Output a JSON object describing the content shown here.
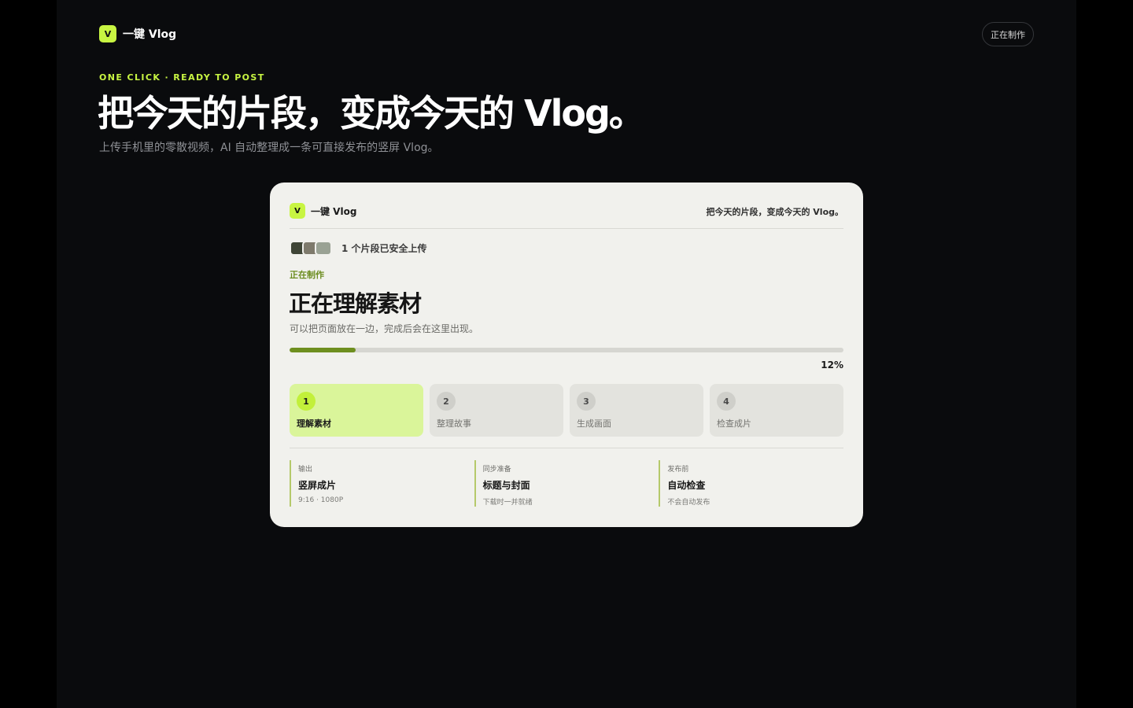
{
  "brand": {
    "mark": "V",
    "name": "一键 Vlog"
  },
  "header": {
    "status_button": "正在制作"
  },
  "hero": {
    "eyebrow": "ONE CLICK · READY TO POST",
    "title": "把今天的片段，变成今天的 Vlog。",
    "subtitle": "上传手机里的零散视频，AI 自动整理成一条可直接发布的竖屏 Vlog。"
  },
  "card": {
    "brand_mark": "V",
    "brand_name": "一键 Vlog",
    "tagline": "把今天的片段，变成今天的 Vlog。",
    "uploads": {
      "text": "1 个片段已安全上传",
      "thumb_colors": [
        "#3f4536",
        "#7e7a6c",
        "#9aa294"
      ]
    },
    "stage_label": "正在制作",
    "stage_title": "正在理解素材",
    "stage_hint": "可以把页面放在一边，完成后会在这里出现。",
    "progress": {
      "value": 0.12,
      "label": "12%"
    },
    "steps": [
      {
        "num": "1",
        "label": "理解素材",
        "active": true
      },
      {
        "num": "2",
        "label": "整理故事",
        "active": false
      },
      {
        "num": "3",
        "label": "生成画面",
        "active": false
      },
      {
        "num": "4",
        "label": "检查成片",
        "active": false
      }
    ],
    "info": [
      {
        "kicker": "输出",
        "title": "竖屏成片",
        "note": "9:16 · 1080P"
      },
      {
        "kicker": "同步准备",
        "title": "标题与封面",
        "note": "下载时一并就绪"
      },
      {
        "kicker": "发布前",
        "title": "自动检查",
        "note": "不会自动发布"
      }
    ]
  },
  "colors": {
    "accent": "#c8f542",
    "progress": "#6e8f1f",
    "card_bg": "#f1f1ed",
    "page_bg": "#0a0b0d"
  }
}
